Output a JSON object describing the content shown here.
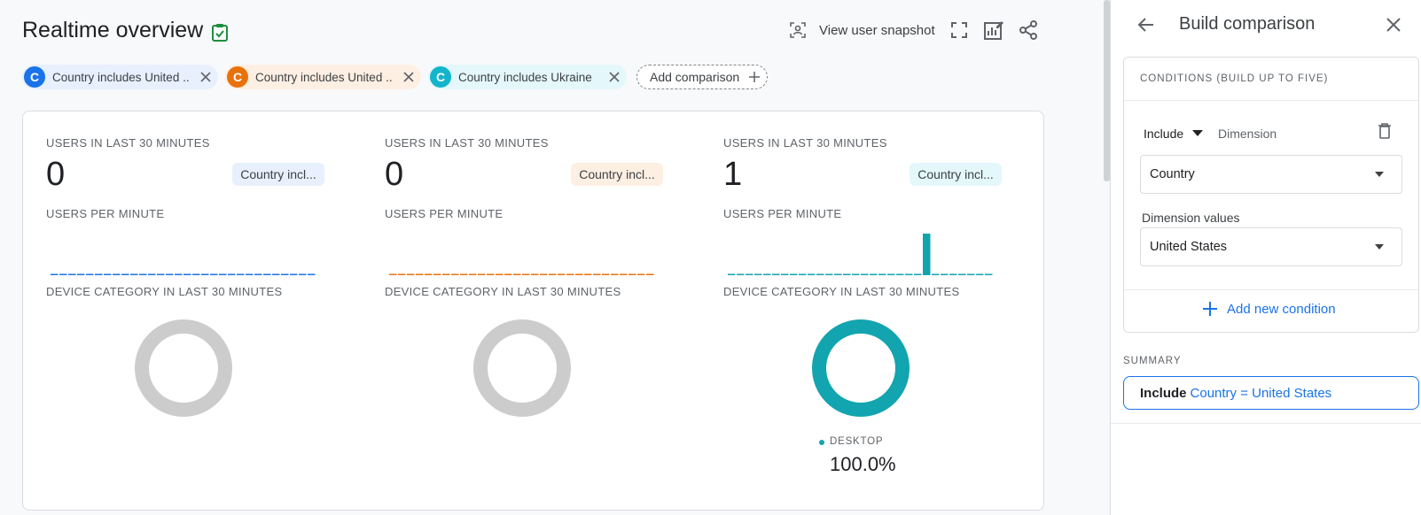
{
  "header": {
    "title": "Realtime overview",
    "view_snapshot_label": "View user snapshot"
  },
  "comparisons": [
    {
      "badge": "C",
      "label": "Country includes United ...",
      "color": "#1a73e8",
      "bg": "#e8f0fe"
    },
    {
      "badge": "C",
      "label": "Country includes United ...",
      "color": "#e8710a",
      "bg": "#feefe3"
    },
    {
      "badge": "C",
      "label": "Country includes Ukraine",
      "color": "#12b5cb",
      "bg": "#e4f7fb"
    }
  ],
  "add_comparison_label": "Add comparison",
  "columns": [
    {
      "users_label": "USERS IN LAST 30 MINUTES",
      "users_value": "0",
      "pill": "Country incl...",
      "pill_bg": "#e8f0fe",
      "per_minute_label": "USERS PER MINUTE",
      "spark_color": "#1a73e8",
      "per_minute": [
        0,
        0,
        0,
        0,
        0,
        0,
        0,
        0,
        0,
        0,
        0,
        0,
        0,
        0,
        0,
        0,
        0,
        0,
        0,
        0,
        0,
        0,
        0,
        0,
        0,
        0,
        0,
        0,
        0,
        0
      ],
      "device_label": "DEVICE CATEGORY IN LAST 30 MINUTES",
      "donut_color": "#cccccc"
    },
    {
      "users_label": "USERS IN LAST 30 MINUTES",
      "users_value": "0",
      "pill": "Country incl...",
      "pill_bg": "#feefe3",
      "per_minute_label": "USERS PER MINUTE",
      "spark_color": "#e8710a",
      "per_minute": [
        0,
        0,
        0,
        0,
        0,
        0,
        0,
        0,
        0,
        0,
        0,
        0,
        0,
        0,
        0,
        0,
        0,
        0,
        0,
        0,
        0,
        0,
        0,
        0,
        0,
        0,
        0,
        0,
        0,
        0
      ],
      "device_label": "DEVICE CATEGORY IN LAST 30 MINUTES",
      "donut_color": "#cccccc"
    },
    {
      "users_label": "USERS IN LAST 30 MINUTES",
      "users_value": "1",
      "pill": "Country incl...",
      "pill_bg": "#e4f7fb",
      "per_minute_label": "USERS PER MINUTE",
      "spark_color": "#12a4af",
      "per_minute": [
        0,
        0,
        0,
        0,
        0,
        0,
        0,
        0,
        0,
        0,
        0,
        0,
        0,
        0,
        0,
        0,
        0,
        0,
        0,
        0,
        0,
        0,
        1,
        0,
        0,
        0,
        0,
        0,
        0,
        0
      ],
      "device_label": "DEVICE CATEGORY IN LAST 30 MINUTES",
      "donut_color": "#12a4af",
      "legend": {
        "label": "DESKTOP",
        "value": "100.0%"
      }
    }
  ],
  "panel": {
    "title": "Build comparison",
    "conditions_title": "CONDITIONS (BUILD UP TO FIVE)",
    "include_label": "Include",
    "dimension_label": "Dimension",
    "dimension_value": "Country",
    "dimension_values_label": "Dimension values",
    "dimension_values_value": "United States",
    "add_condition_label": "Add new condition",
    "summary_title": "SUMMARY",
    "summary_include": "Include",
    "summary_condition": "Country = United States"
  }
}
